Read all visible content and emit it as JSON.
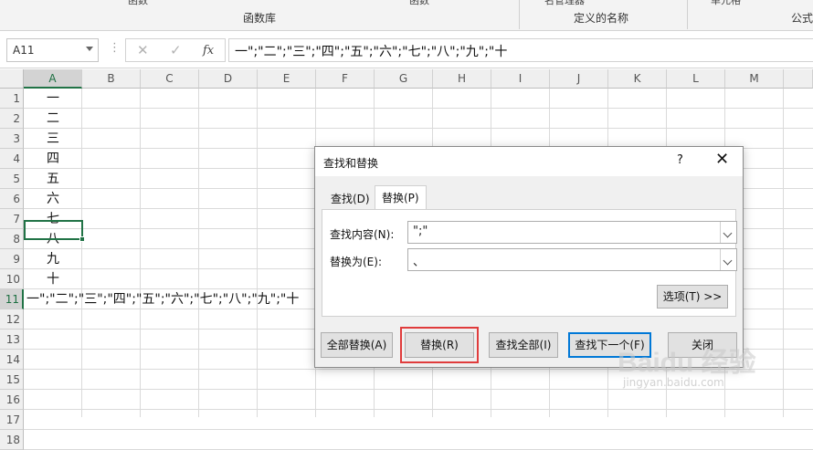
{
  "ribbon": {
    "cut_labels": [
      "函数",
      "函数",
      "名管理器",
      "单元格"
    ],
    "group_function_library": "函数库",
    "group_defined_names": "定义的名称",
    "group_formula": "公式"
  },
  "formula_bar": {
    "name_box": "A11",
    "dots": "⋮",
    "cancel_icon": "✕",
    "enter_icon": "✓",
    "fx_label": "fx",
    "formula": "一\";\"二\";\"三\";\"四\";\"五\";\"六\";\"七\";\"八\";\"九\";\"十"
  },
  "sheet": {
    "columns": [
      "A",
      "B",
      "C",
      "D",
      "E",
      "F",
      "G",
      "H",
      "I",
      "J",
      "K",
      "L",
      "M"
    ],
    "rows": [
      "1",
      "2",
      "3",
      "4",
      "5",
      "6",
      "7",
      "8",
      "9",
      "10",
      "11",
      "12",
      "13",
      "14",
      "15",
      "16",
      "17",
      "18"
    ],
    "active_cell": "A11",
    "column_a_values": [
      "一",
      "二",
      "三",
      "四",
      "五",
      "六",
      "七",
      "八",
      "九",
      "十"
    ],
    "a11_value": "一\";\"二\";\"三\";\"四\";\"五\";\"六\";\"七\";\"八\";\"九\";\"十"
  },
  "dialog": {
    "title": "查找和替换",
    "help": "?",
    "close": "✕",
    "tabs": [
      "查找(D)",
      "替换(P)"
    ],
    "active_tab": "替换(P)",
    "find_label": "查找内容(N):",
    "find_value": "\";\"",
    "replace_label": "替换为(E):",
    "replace_value": "、",
    "options_button": "选项(T) >>",
    "buttons": {
      "replace_all": "全部替换(A)",
      "replace": "替换(R)",
      "find_all": "查找全部(I)",
      "find_next": "查找下一个(F)",
      "close": "关闭"
    }
  },
  "watermark": {
    "brand": "Baidu 经验",
    "url": "jingyan.baidu.com"
  },
  "colors": {
    "excel_green": "#217346",
    "highlight_red": "#e03c3c",
    "default_button_blue": "#0078d7"
  }
}
